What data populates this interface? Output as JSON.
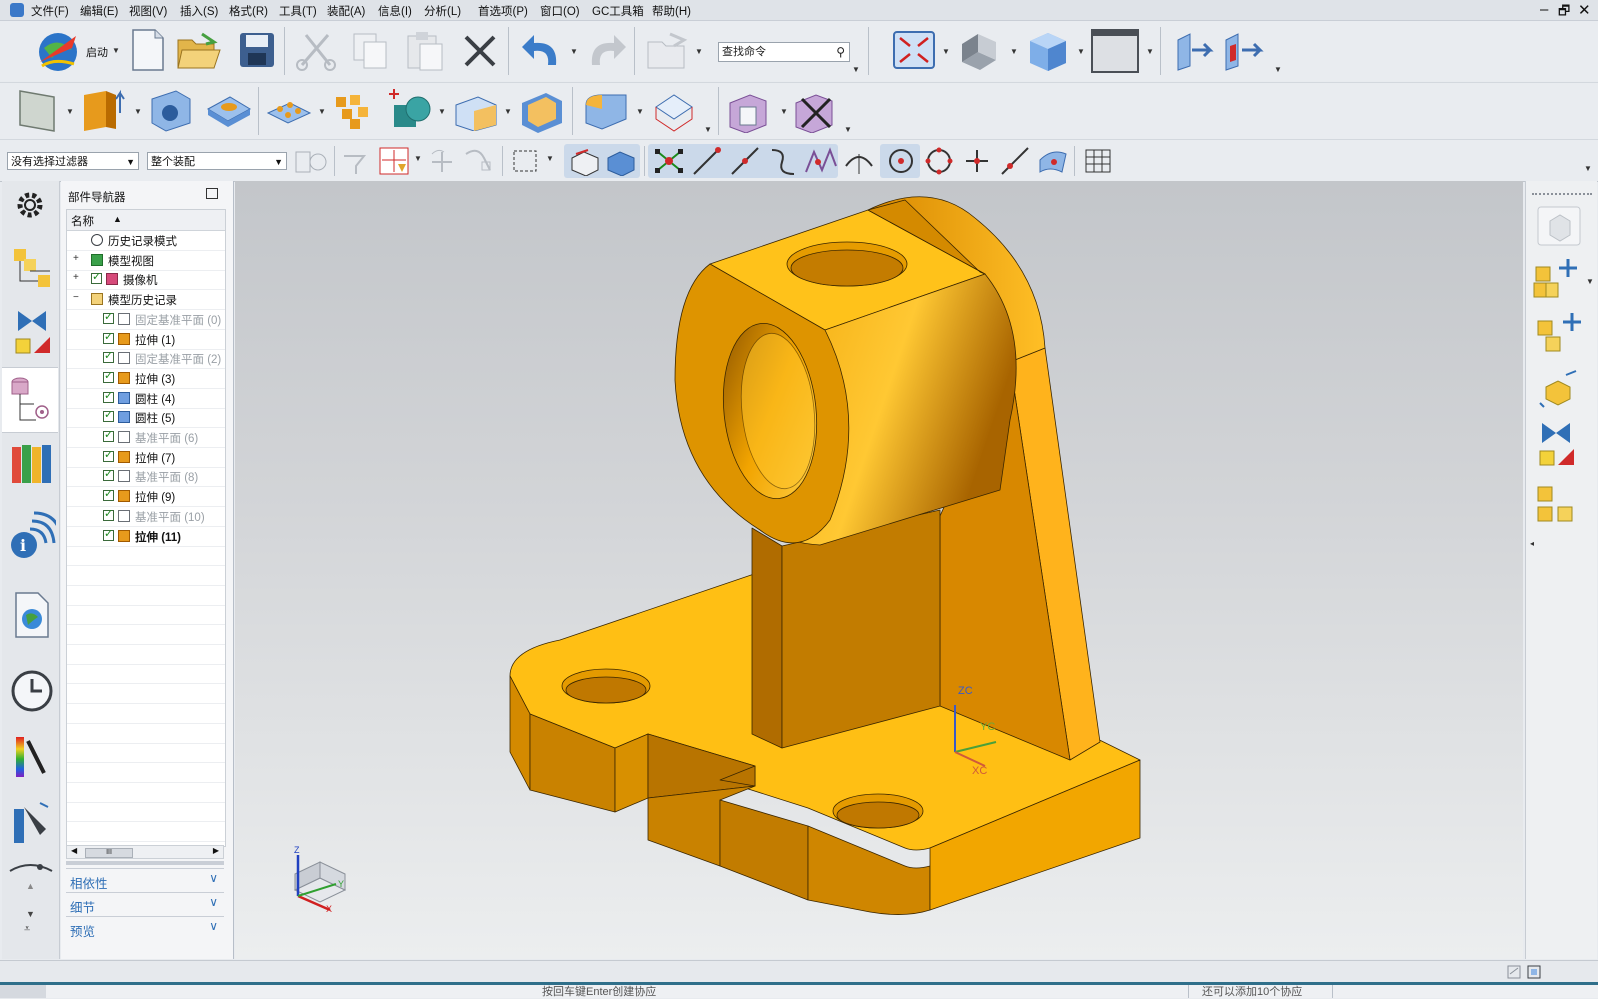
{
  "menubar": {
    "items": [
      "文件(F)",
      "编辑(E)",
      "视图(V)",
      "插入(S)",
      "格式(R)",
      "工具(T)",
      "装配(A)",
      "信息(I)",
      "分析(L)",
      "首选项(P)",
      "窗口(O)",
      "GC工具箱",
      "帮助(H)"
    ]
  },
  "window_controls": {
    "minimize": "–",
    "restore": "🗗",
    "close": "✕"
  },
  "toolbar1": {
    "start_label": "启动",
    "search_placeholder": "查找命令"
  },
  "filters": {
    "selection_filter": "没有选择过滤器",
    "scope": "整个装配"
  },
  "navigator": {
    "title": "部件导航器",
    "column_header": "名称",
    "sort_indicator": "▲",
    "items": [
      {
        "label": "历史记录模式",
        "indent": 0,
        "expander": "",
        "check": false,
        "icon": "clock-icon",
        "grey": false,
        "bold": false
      },
      {
        "label": "模型视图",
        "indent": 0,
        "expander": "+",
        "check": false,
        "icon": "model-view-icon",
        "grey": false,
        "bold": false
      },
      {
        "label": "摄像机",
        "indent": 0,
        "expander": "+",
        "check": true,
        "icon": "camera-icon",
        "grey": false,
        "bold": false
      },
      {
        "label": "模型历史记录",
        "indent": 0,
        "expander": "−",
        "check": false,
        "icon": "folder-icon",
        "grey": false,
        "bold": false
      },
      {
        "label": "固定基准平面 (0)",
        "indent": 1,
        "expander": "",
        "check": true,
        "icon": "datum-plane-icon",
        "grey": true,
        "bold": false
      },
      {
        "label": "拉伸 (1)",
        "indent": 1,
        "expander": "",
        "check": true,
        "icon": "extrude-icon",
        "grey": false,
        "bold": false
      },
      {
        "label": "固定基准平面 (2)",
        "indent": 1,
        "expander": "",
        "check": true,
        "icon": "datum-plane-icon",
        "grey": true,
        "bold": false
      },
      {
        "label": "拉伸 (3)",
        "indent": 1,
        "expander": "",
        "check": true,
        "icon": "extrude-icon",
        "grey": false,
        "bold": false
      },
      {
        "label": "圆柱 (4)",
        "indent": 1,
        "expander": "",
        "check": true,
        "icon": "cylinder-icon",
        "grey": false,
        "bold": false
      },
      {
        "label": "圆柱 (5)",
        "indent": 1,
        "expander": "",
        "check": true,
        "icon": "cylinder-icon",
        "grey": false,
        "bold": false
      },
      {
        "label": "基准平面 (6)",
        "indent": 1,
        "expander": "",
        "check": true,
        "icon": "datum-plane-icon",
        "grey": true,
        "bold": false
      },
      {
        "label": "拉伸 (7)",
        "indent": 1,
        "expander": "",
        "check": true,
        "icon": "extrude-icon",
        "grey": false,
        "bold": false
      },
      {
        "label": "基准平面 (8)",
        "indent": 1,
        "expander": "",
        "check": true,
        "icon": "datum-plane-icon",
        "grey": true,
        "bold": false
      },
      {
        "label": "拉伸 (9)",
        "indent": 1,
        "expander": "",
        "check": true,
        "icon": "extrude-icon",
        "grey": false,
        "bold": false
      },
      {
        "label": "基准平面 (10)",
        "indent": 1,
        "expander": "",
        "check": true,
        "icon": "datum-plane-icon",
        "grey": true,
        "bold": false
      },
      {
        "label": "拉伸 (11)",
        "indent": 1,
        "expander": "",
        "check": true,
        "icon": "extrude-icon",
        "grey": false,
        "bold": true
      }
    ],
    "scroll_thumb": "III",
    "sections": [
      "相依性",
      "细节",
      "预览"
    ]
  },
  "axes": {
    "zc": "ZC",
    "yc": "YC",
    "xc": "XC",
    "z": "Z",
    "y": "Y",
    "x": "X"
  },
  "status": {
    "left_text": "按回车键Enter创建协应",
    "right_text": "还可以添加10个协应"
  },
  "colors": {
    "part_face_light": "#ffc21a",
    "part_face_mid": "#f0a400",
    "part_face_dark": "#c87d00",
    "accent_blue": "#2f6fb6"
  }
}
